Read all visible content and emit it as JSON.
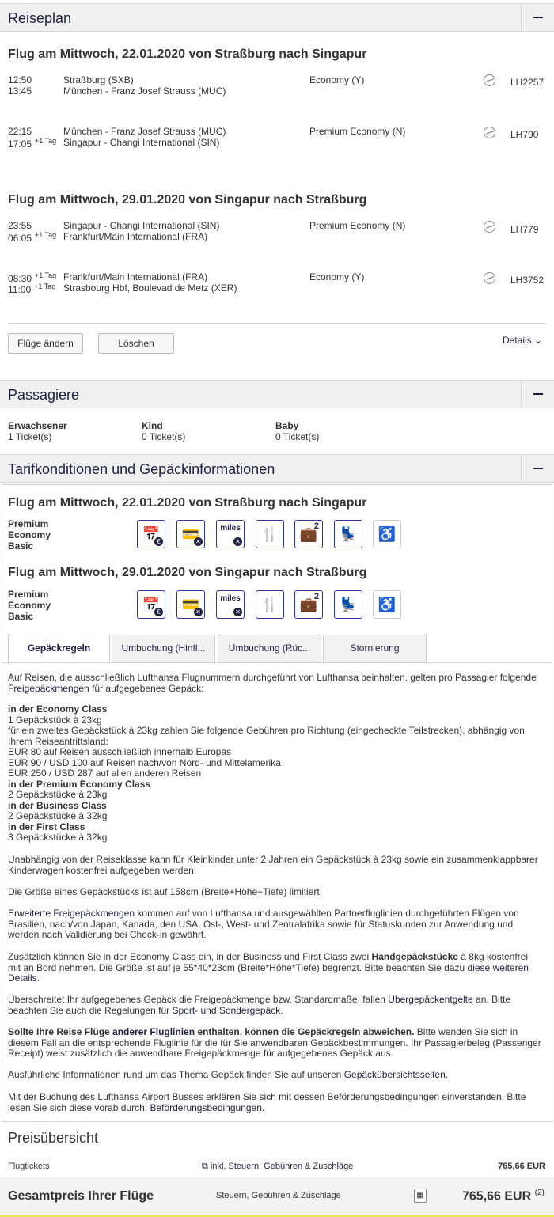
{
  "reiseplan": {
    "title": "Reiseplan",
    "outbound": {
      "heading": "Flug am Mittwoch, 22.01.2020 von Straßburg nach Singapur",
      "segments": [
        {
          "dep_time": "12:50",
          "arr_time": "13:45",
          "dep_plus": "",
          "arr_plus": "",
          "from": "Straßburg (SXB)",
          "to": "München - Franz Josef Strauss (MUC)",
          "class": "Economy (Y)",
          "flight": "LH2257"
        },
        {
          "dep_time": "22:15",
          "arr_time": "17:05",
          "dep_plus": "",
          "arr_plus": "+1 Tag",
          "from": "München - Franz Josef Strauss (MUC)",
          "to": "Singapur - Changi International (SIN)",
          "class": "Premium Economy (N)",
          "flight": "LH790"
        }
      ]
    },
    "inbound": {
      "heading": "Flug am Mittwoch, 29.01.2020 von Singapur nach Straßburg",
      "segments": [
        {
          "dep_time": "23:55",
          "arr_time": "06:05",
          "dep_plus": "",
          "arr_plus": "+1 Tag",
          "from": "Singapur - Changi International (SIN)",
          "to": "Frankfurt/Main International (FRA)",
          "class": "Premium Economy (N)",
          "flight": "LH779"
        },
        {
          "dep_time": "08:30",
          "arr_time": "11:00",
          "dep_plus": "+1 Tag",
          "arr_plus": "+1 Tag",
          "from": "Frankfurt/Main International (FRA)",
          "to": "Strasbourg Hbf, Boulevad de Metz (XER)",
          "class": "Economy (Y)",
          "flight": "LH3752"
        }
      ]
    },
    "buttons": {
      "change": "Flüge ändern",
      "delete": "Löschen",
      "details": "Details"
    }
  },
  "passagiere": {
    "title": "Passagiere",
    "items": [
      {
        "label": "Erwachsener",
        "value": "1 Ticket(s)"
      },
      {
        "label": "Kind",
        "value": "0 Ticket(s)"
      },
      {
        "label": "Baby",
        "value": "0 Ticket(s)"
      }
    ]
  },
  "tarif": {
    "title": "Tarifkonditionen und Gepäckinformationen",
    "flights": [
      {
        "heading": "Flug am Mittwoch, 22.01.2020 von Straßburg nach Singapur",
        "fare_l1": "Premium",
        "fare_l2": "Economy",
        "fare_l3": "Basic"
      },
      {
        "heading": "Flug am Mittwoch, 29.01.2020 von Singapur nach Straßburg",
        "fare_l1": "Premium",
        "fare_l2": "Economy",
        "fare_l3": "Basic"
      }
    ],
    "icons": [
      "rebooking-fee-icon",
      "refund-not-allowed-icon",
      "miles-not-earned-icon",
      "meal-icon",
      "baggage-2-icon",
      "seat-selection-icon",
      "wheelchair-icon"
    ],
    "miles_label": "miles",
    "bag_count": "2",
    "tabs": [
      "Gepäckregeln",
      "Umbuchung (Hinfl...",
      "Umbuchung (Rüc...",
      "Stornierung"
    ]
  },
  "rules": {
    "p1a": "Auf Reisen, die ausschließlich Lufthansa Flugnummern durchgeführt von Lufthansa beinhalten, gelten pro Passagier folgende",
    "p1_link": "Freigepäckmengen",
    "p1b": " für aufgegebenes Gepäck:",
    "eco_h": "in der Economy Class",
    "eco_1": "1 Gepäckstück à 23kg",
    "eco_2": "für ein zweites Gepäckstück à 23kg zahlen Sie folgende Gebühren pro Richtung (eingecheckte Teilstrecken), abhängig von",
    "eco_3": "Ihrem Reiseantrittsland:",
    "eco_4": "EUR 80 auf Reisen ausschließlich innerhalb Europas",
    "eco_5": "EUR 90 / USD 100 auf Reisen nach/von Nord- und Mittelamerika",
    "eco_6": "EUR 250 / USD 287 auf allen anderen Reisen",
    "pe_h": "in der Premium Economy Class",
    "pe_1": "2 Gepäckstücke à 23kg",
    "bc_h": "in der Business Class",
    "bc_1": "2 Gepäckstücke à 32kg",
    "fc_h": "in der First Class",
    "fc_1": "3 Gepäckstücke à 32kg",
    "p2a": "Unabhängig von der Reiseklasse kann für Kleinkinder unter 2 Jahren ein Gepäckstück à 23kg sowie ein zusammenklappbarer",
    "p2b": "Kinderwagen kostenfrei aufgegeben werden.",
    "p3": "Die Größe eines Gepäckstücks ist auf 158cm (Breite+Höhe+Tiefe) limitiert.",
    "p4_link": "Erweiterte Freigepäckmengen",
    "p4a": " kommen auf von Lufthansa und ausgewählten Partnerfluglinien durchgeführten Flügen von",
    "p4b": "Brasilien, nach/von Japan, Kanada, den USA, Ost-, West- und Zentralafrika sowie für Statuskunden zur Anwendung und",
    "p4c": "werden nach Validierung bei Check-in gewährt.",
    "p5a": "Zusätzlich können Sie in der Economy Class ein, in der Business und First Class zwei ",
    "p5_bold": "Handgepäckstücke",
    "p5b": " à 8kg kostenfrei",
    "p5c": "mit an Bord nehmen. Die Größe ist auf je 55*40*23cm (Breite*Höhe*Tiefe) begrenzt. Bitte beachten Sie dazu ",
    "p5_link1": "diese weiteren",
    "p5_link2": "Details",
    "p5d": ".",
    "p6a": "Überschreitet Ihr aufgegebenes Gepäck die Freigepäckmenge bzw. Standardmaße, fallen ",
    "p6_link1": "Übergepäckentgelte",
    "p6b": " an. Bitte",
    "p6c": "beachten Sie auch die Regelungen für ",
    "p6_link2": "Sport- und Sondergepäck",
    "p6d": ".",
    "p7_bold1": "Sollte Ihre Reise Flüge ",
    "p7_link": "anderer Fluglinien",
    "p7_bold2": " enthalten, können die Gepäckregeln abweichen.",
    "p7a": " Bitte wenden Sie sich in",
    "p7b": "diesem Fall an die entsprechende Fluglinie für die für Sie anwendbaren Gepäckbestimmungen. Ihr Passagierbeleg (Passenger",
    "p7c": "Receipt) weist zusätzlich die anwendbare Freigepäckmenge für aufgegebenes Gepäck aus.",
    "p8a": "Ausführliche Informationen rund um das Thema Gepäck finden Sie auf unseren ",
    "p8_link": "Gepäckübersichtsseiten",
    "p8b": ".",
    "p9a": "Mit der Buchung des Lufthansa Airport Busses erklären Sie sich mit dessen Beförderungsbedingungen einverstanden. Bitte",
    "p9b": "lesen Sie sich diese vorab durch: ",
    "p9_link": "Beförderungsbedingungen",
    "p9c": "."
  },
  "preis": {
    "title": "Preisübersicht",
    "tickets_label": "Flugtickets",
    "tickets_link": "inkl. Steuern, Gebühren & Zuschläge",
    "tickets_value": "765,66 EUR",
    "total_label": "Gesamtpreis Ihrer Flüge",
    "total_sub": "Steuern, Gebühren & Zuschläge",
    "total_value": "765,66 EUR",
    "total_note": "(2)"
  },
  "colors": {
    "brand": "#1f2140",
    "accent_bar": "#e8e85a"
  }
}
